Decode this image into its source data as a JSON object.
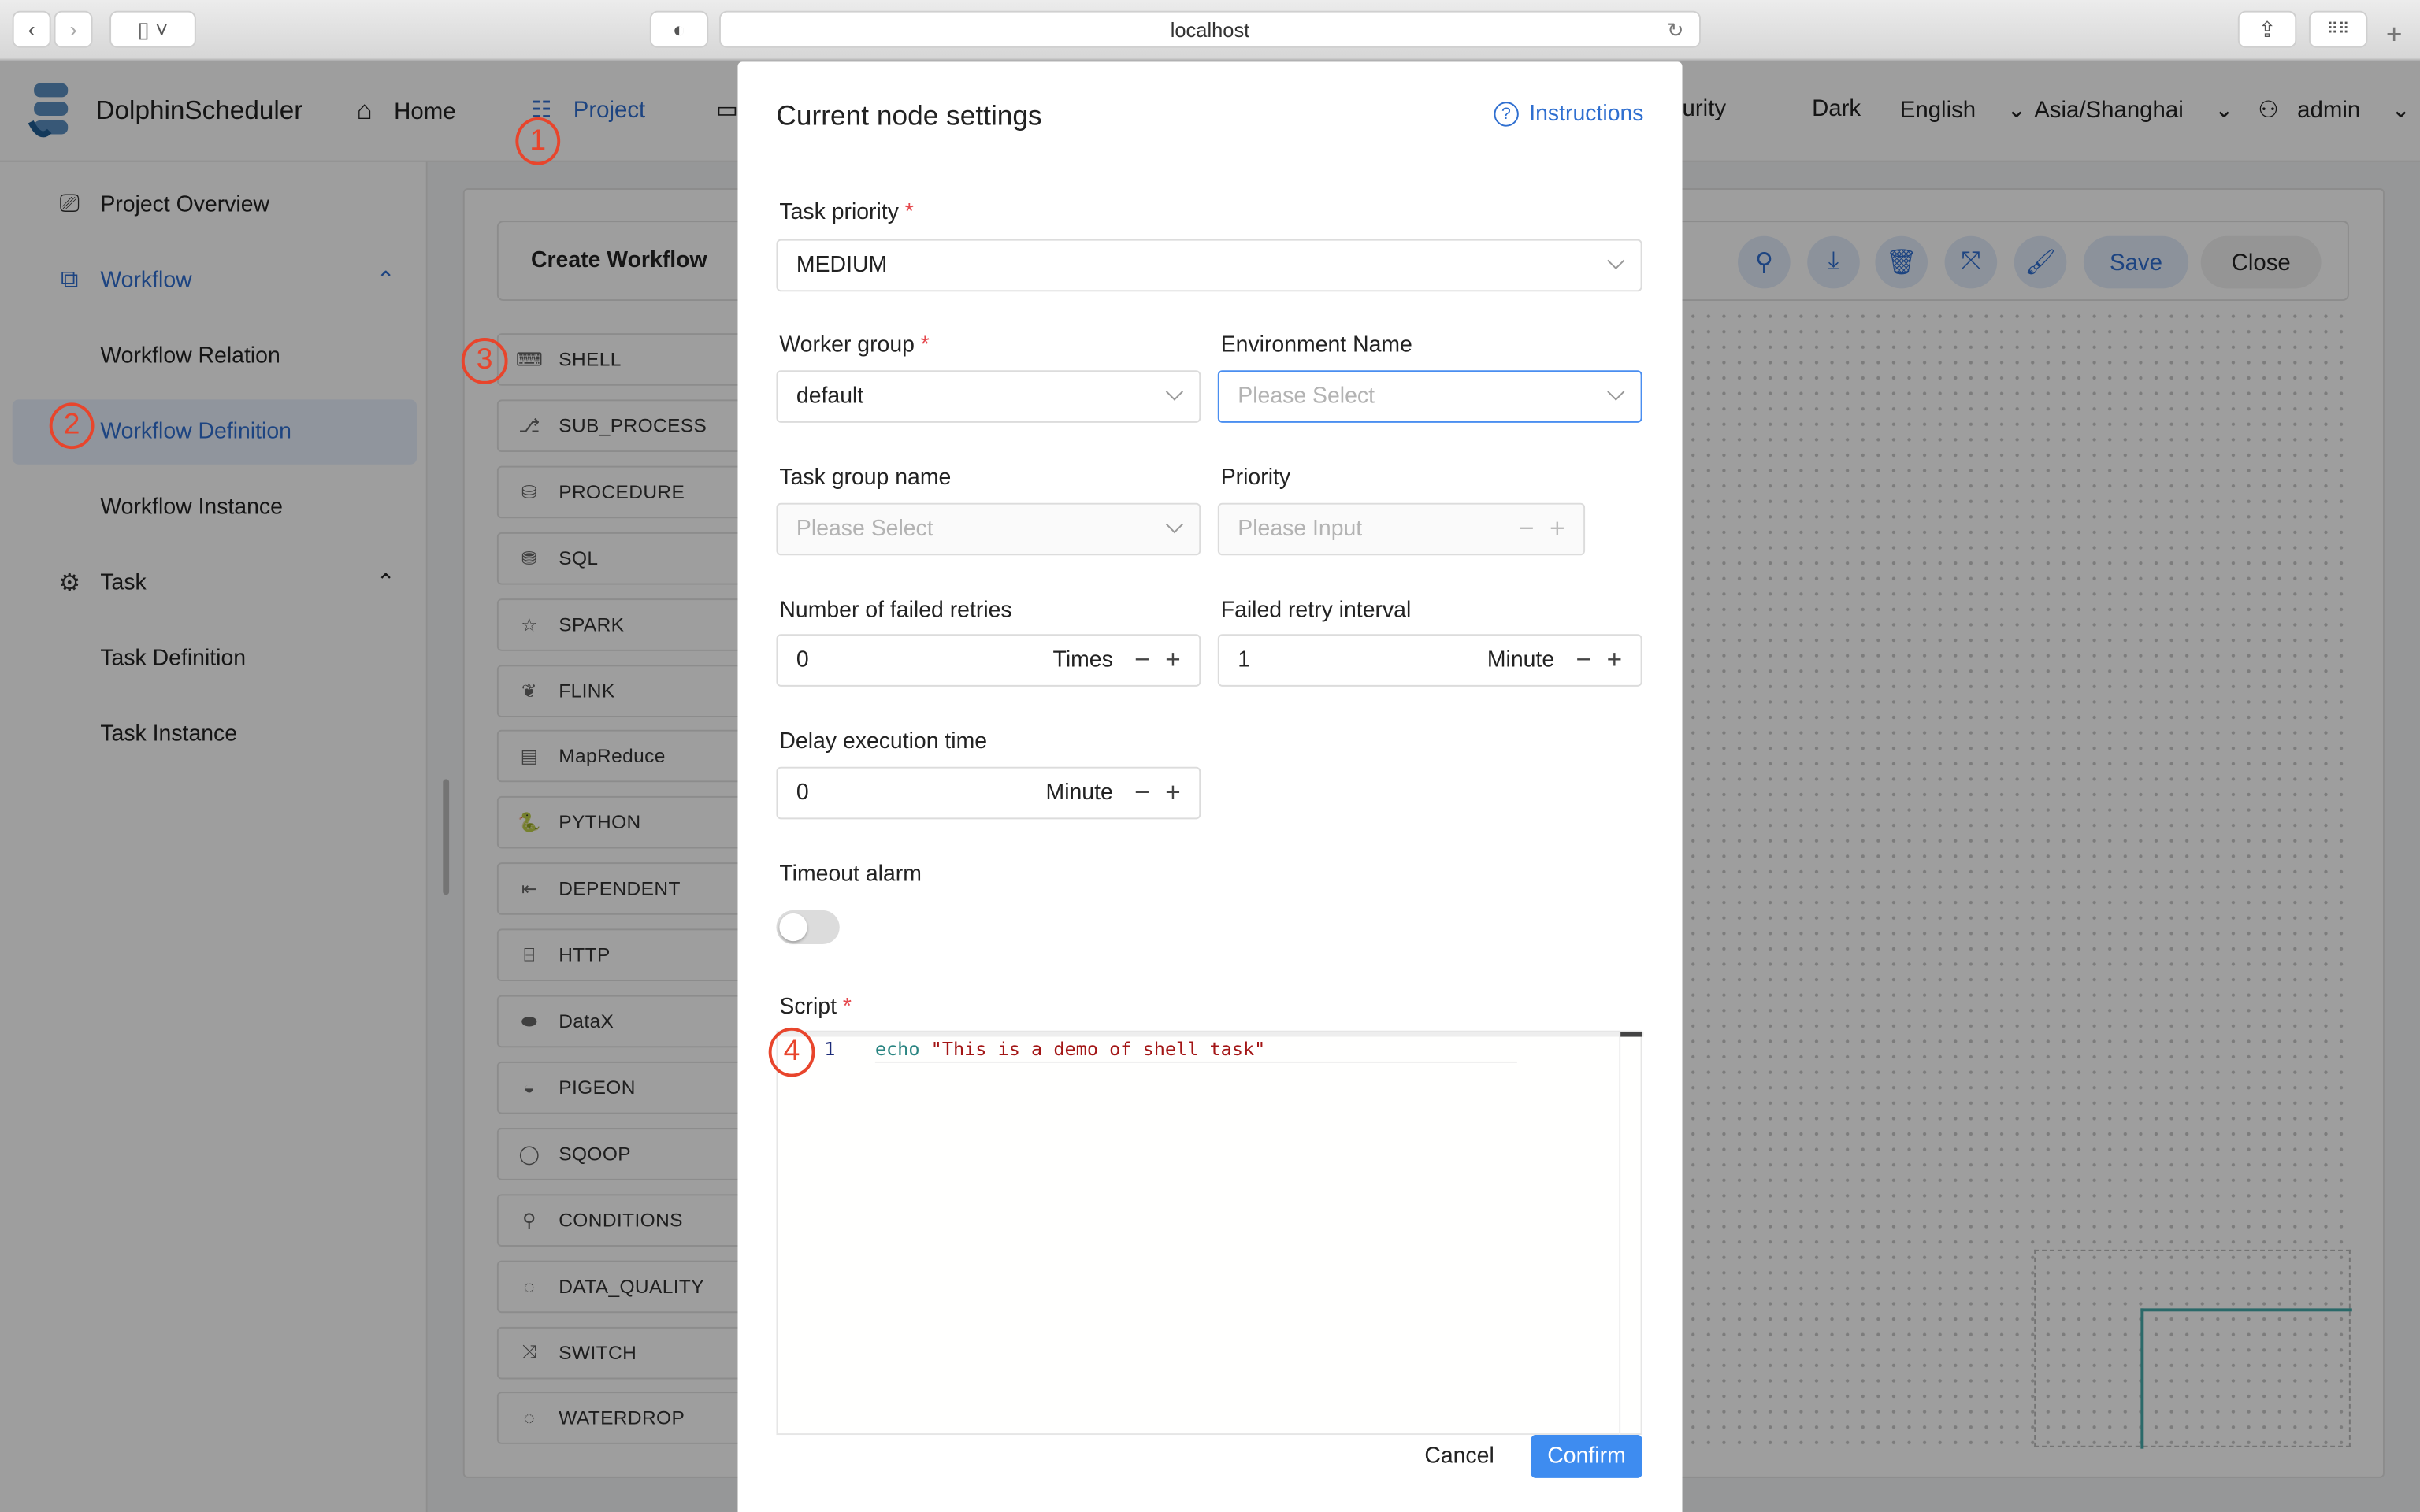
{
  "browser": {
    "url": "localhost"
  },
  "app": {
    "name": "DolphinScheduler"
  },
  "nav": {
    "home": "Home",
    "project": "Project",
    "security_partial": "urity",
    "theme": "Dark",
    "language": "English",
    "timezone": "Asia/Shanghai",
    "user": "admin"
  },
  "sidebar": {
    "items": [
      {
        "label": "Project Overview"
      },
      {
        "label": "Workflow"
      },
      {
        "label": "Workflow Relation"
      },
      {
        "label": "Workflow Definition"
      },
      {
        "label": "Workflow Instance"
      },
      {
        "label": "Task"
      },
      {
        "label": "Task Definition"
      },
      {
        "label": "Task Instance"
      }
    ]
  },
  "editor": {
    "title": "Create Workflow",
    "save": "Save",
    "close": "Close"
  },
  "tasks": [
    "SHELL",
    "SUB_PROCESS",
    "PROCEDURE",
    "SQL",
    "SPARK",
    "FLINK",
    "MapReduce",
    "PYTHON",
    "DEPENDENT",
    "HTTP",
    "DataX",
    "PIGEON",
    "SQOOP",
    "CONDITIONS",
    "DATA_QUALITY",
    "SWITCH",
    "WATERDROP"
  ],
  "modal": {
    "title": "Current node settings",
    "instructions": "Instructions",
    "task_priority": {
      "label": "Task priority",
      "value": "MEDIUM"
    },
    "worker_group": {
      "label": "Worker group",
      "value": "default"
    },
    "environment": {
      "label": "Environment Name",
      "placeholder": "Please Select"
    },
    "task_group": {
      "label": "Task group name",
      "placeholder": "Please Select"
    },
    "priority": {
      "label": "Priority",
      "placeholder": "Please Input"
    },
    "retries": {
      "label": "Number of failed retries",
      "value": "0",
      "unit": "Times"
    },
    "retry_interval": {
      "label": "Failed retry interval",
      "value": "1",
      "unit": "Minute"
    },
    "delay": {
      "label": "Delay execution time",
      "value": "0",
      "unit": "Minute"
    },
    "timeout": {
      "label": "Timeout alarm",
      "enabled": false
    },
    "script": {
      "label": "Script",
      "line_no": "1",
      "keyword": "echo",
      "string": "\"This is a demo of shell task\""
    },
    "cancel": "Cancel",
    "confirm": "Confirm"
  },
  "annotations": [
    "1",
    "2",
    "3",
    "4"
  ],
  "colors": {
    "accent": "#2f6fd0",
    "annotation": "#e8452c",
    "confirm": "#3e8cf0"
  }
}
